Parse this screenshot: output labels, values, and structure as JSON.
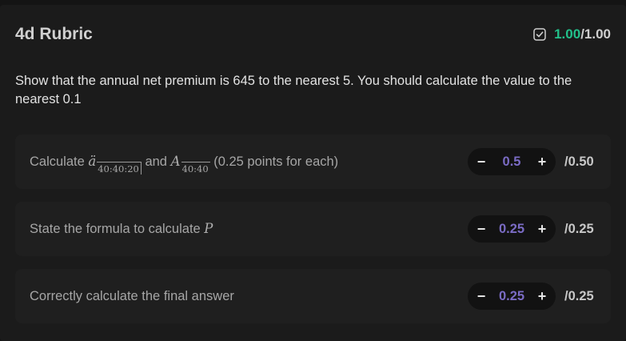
{
  "rubric": {
    "title": "4d Rubric",
    "score_earned": "1.00",
    "score_total": "/1.00",
    "prompt": "Show that the annual net premium is 645 to the nearest 5. You should calculate the value to the nearest 0.1"
  },
  "criteria": [
    {
      "label_pre": "Calculate ",
      "math1_base": "ä",
      "math1_sub": "40:40:20",
      "label_mid": " and ",
      "math2_base": "A",
      "math2_sub": "40:40",
      "label_post": " (0.25 points for each)",
      "value": "0.5",
      "max": "/0.50"
    },
    {
      "label_pre": "State the formula to calculate ",
      "math_var": "P",
      "value": "0.25",
      "max": "/0.25"
    },
    {
      "label": "Correctly calculate the final answer",
      "value": "0.25",
      "max": "/0.25"
    }
  ],
  "stepper": {
    "minus": "−",
    "plus": "+"
  },
  "colors": {
    "earned": "#22c08a",
    "value": "#7a6bc4",
    "background": "#1b1b1b"
  },
  "icons": {
    "score": "checkbox-check-icon"
  }
}
